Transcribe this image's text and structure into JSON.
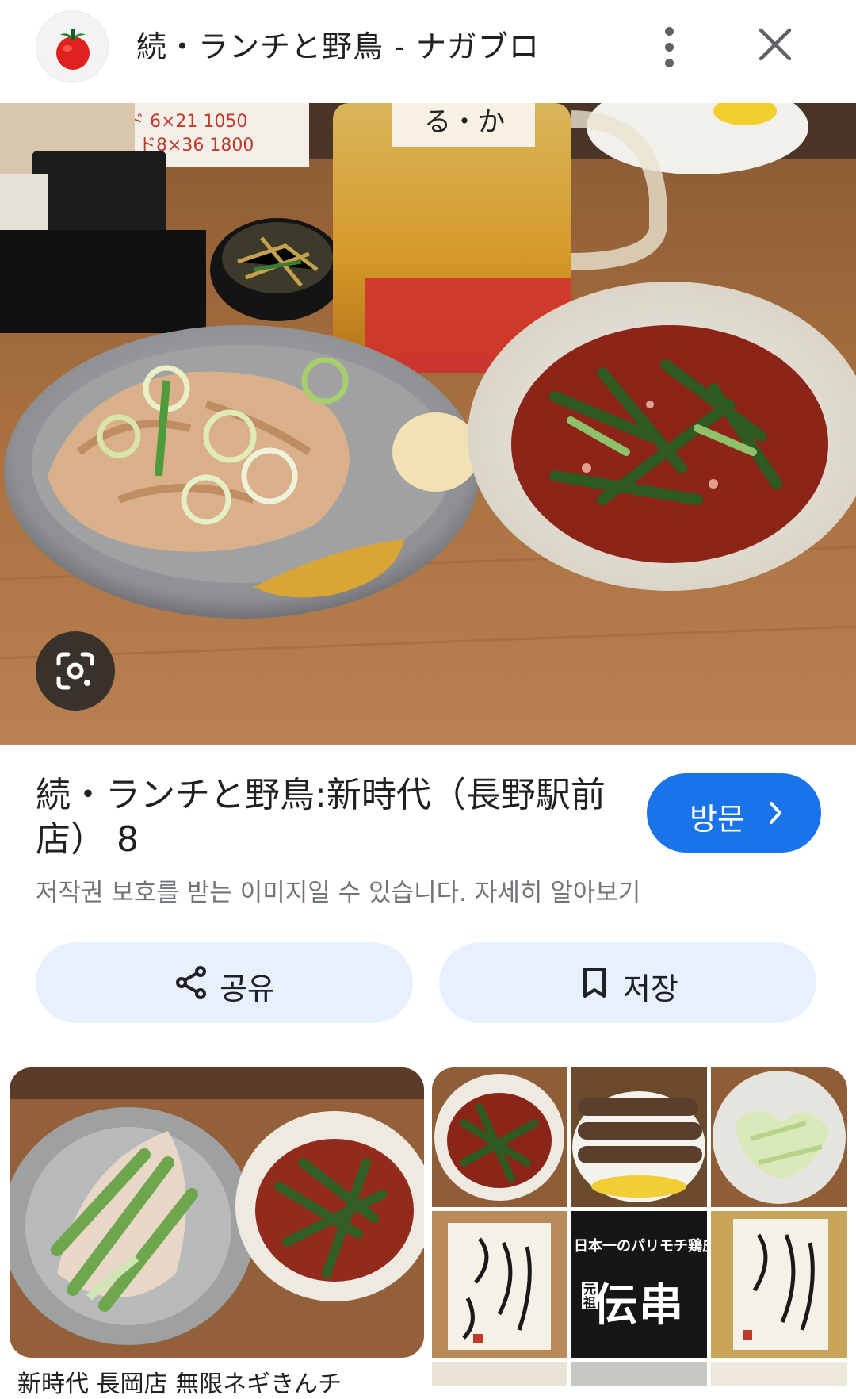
{
  "header": {
    "title": "続・ランチと野鳥 - ナガブロ",
    "logo_icon": "tomato-icon",
    "more_icon": "more-vertical-icon",
    "close_icon": "close-icon"
  },
  "hero": {
    "lens_icon": "google-lens-icon"
  },
  "result": {
    "title": "続・ランチと野鳥:新時代（長野駅前店） 8",
    "visit_label": "방문",
    "copyright_notice": "저작권 보호를 받는 이미지일 수 있습니다. 자세히 알아보기"
  },
  "actions": {
    "share_label": "공유",
    "save_label": "저장"
  },
  "related": {
    "caption": "新時代 長岡店 無限ネギきんチ",
    "banner_line": "日本一のパリモチ鶏皮串",
    "banner_big": "伝串",
    "banner_tag": "元祖"
  },
  "colors": {
    "accent": "#1a73e8",
    "action_bg": "#e8f0fe",
    "secondary_text": "#70757a"
  }
}
